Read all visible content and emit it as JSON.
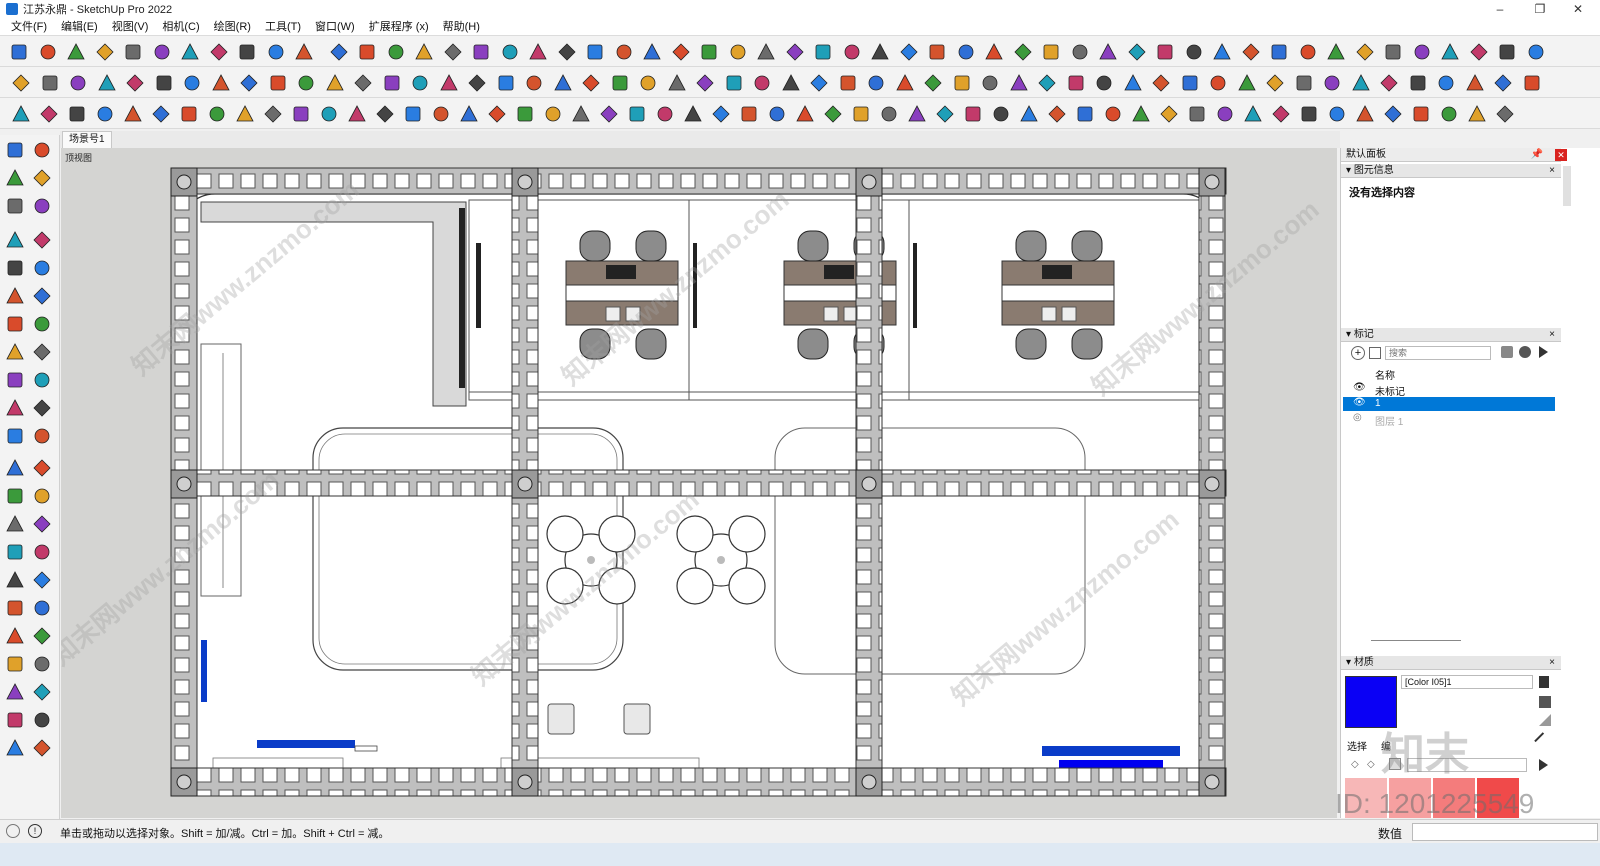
{
  "window": {
    "title": "江苏永鼎 - SketchUp Pro 2022",
    "minimize_glyph": "–",
    "maximize_glyph": "❐",
    "close_glyph": "✕"
  },
  "menu": {
    "items": [
      "文件(F)",
      "编辑(E)",
      "视图(V)",
      "相机(C)",
      "绘图(R)",
      "工具(T)",
      "窗口(W)",
      "扩展程序 (x)",
      "帮助(H)"
    ]
  },
  "scene": {
    "tab_label": "场景号1",
    "view_label": "顶视图"
  },
  "panel": {
    "default_title": "默认面板",
    "entity_info": {
      "header": "图元信息",
      "empty_text": "没有选择内容"
    },
    "tags": {
      "header": "标记",
      "search_placeholder": "搜索",
      "column_name": "名称",
      "rows": [
        "未标记",
        "1",
        "图层 1"
      ]
    },
    "materials": {
      "header": "材质",
      "current_name": "[Color I05]1",
      "swatch_color": "#0a00f5",
      "tab_select": "选择",
      "tab_edit": "编"
    }
  },
  "status": {
    "hint": "单击或拖动以选择对象。Shift = 加/减。Ctrl = 加。Shift + Ctrl = 减。",
    "measurement_label": "数值"
  },
  "watermark": {
    "text_cn": "知末网www.znzmo.com",
    "brand": "知末",
    "id_text": "ID: 1201225549"
  },
  "colors": {
    "selection_blue": "#0078d7",
    "accent_blue": "#0a3cc8"
  }
}
